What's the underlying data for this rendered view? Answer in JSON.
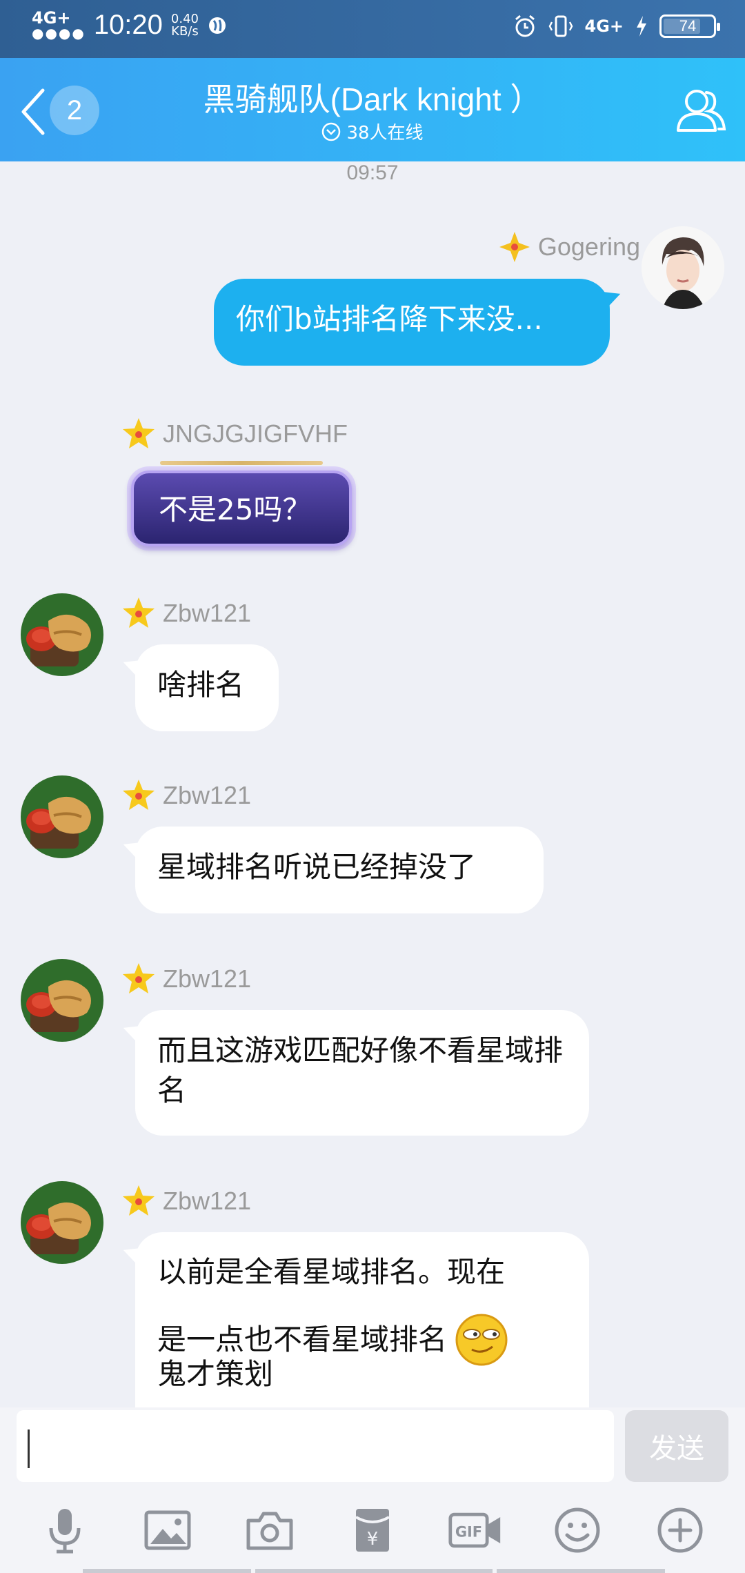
{
  "status_bar": {
    "network": "4G+",
    "time": "10:20",
    "speed_value": "0.40",
    "speed_unit": "KB/s",
    "right_network": "4G+",
    "battery": "74"
  },
  "header": {
    "unread_count": "2",
    "title": "黑骑舰队(Dark knight ）",
    "online_text": "38人在线"
  },
  "chat": {
    "timestamp": "09:57",
    "messages": [
      {
        "sender": "Gogering",
        "text": "你们b站排名降下来没..."
      },
      {
        "sender": "JNGJGJIGFVHF",
        "text": "不是25吗？"
      },
      {
        "sender": "Zbw121",
        "text": "啥排名"
      },
      {
        "sender": "Zbw121",
        "text": "星域排名听说已经掉没了"
      },
      {
        "sender": "Zbw121",
        "text": "而且这游戏匹配好像不看星域排名"
      },
      {
        "sender": "Zbw121",
        "text_line1": "以前是全看星域排名。现在",
        "text_line2": "是一点也不看星域排名",
        "text_line3": "鬼才策划"
      }
    ]
  },
  "input": {
    "value": "",
    "send_label": "发送"
  },
  "colors": {
    "status_bar": "#2f5f93",
    "header_start": "#3aa2f2",
    "header_end": "#2fc1f9",
    "my_bubble": "#1db0ef",
    "background": "#eef0f6"
  },
  "icons": [
    "back-icon",
    "members-icon",
    "microphone-icon",
    "image-icon",
    "camera-icon",
    "red-packet-icon",
    "gif-icon",
    "emoji-icon",
    "plus-icon"
  ]
}
